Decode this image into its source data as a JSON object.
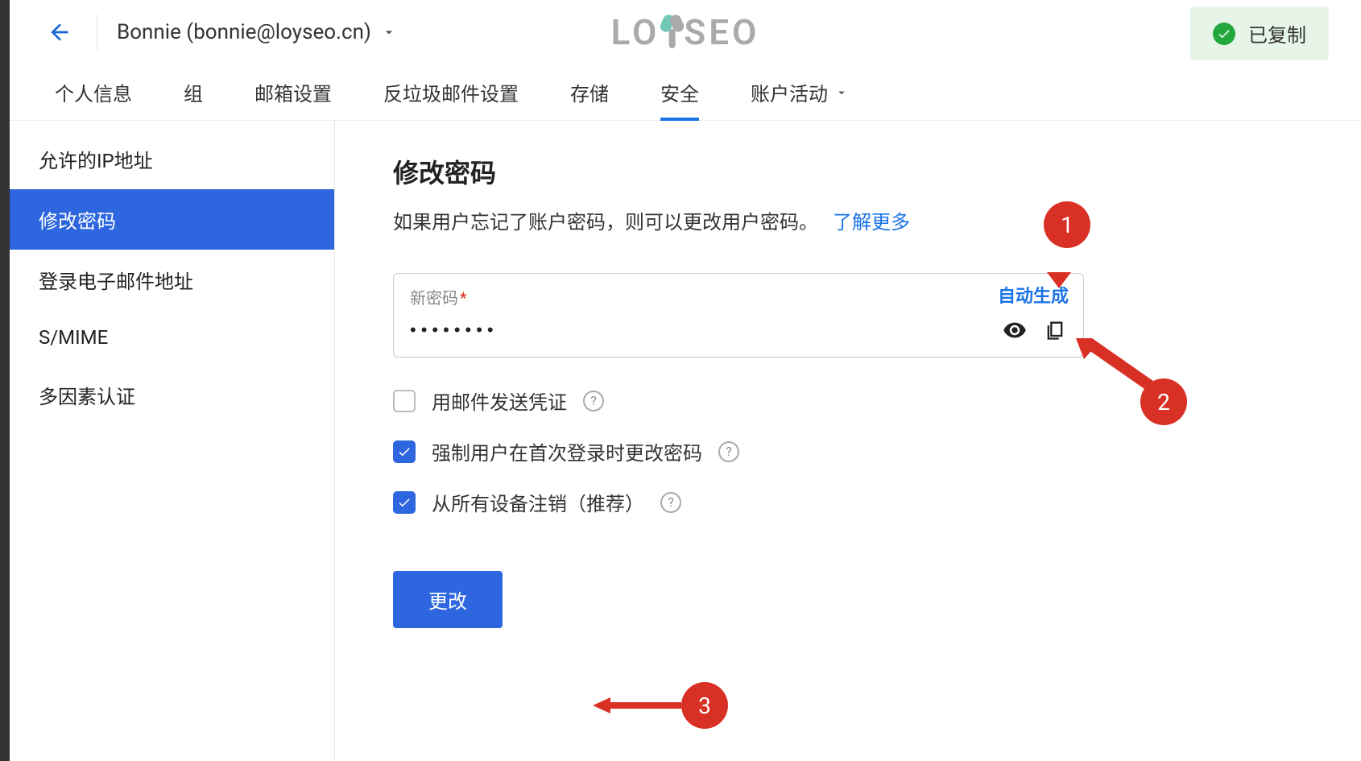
{
  "header": {
    "user_display": "Bonnie (bonnie@loyseo.cn)",
    "logo_text_left": "LO",
    "logo_text_right": "SEO",
    "toast_text": "已复制"
  },
  "tabs": [
    {
      "label": "个人信息"
    },
    {
      "label": "组"
    },
    {
      "label": "邮箱设置"
    },
    {
      "label": "反垃圾邮件设置"
    },
    {
      "label": "存储"
    },
    {
      "label": "安全",
      "active": true
    },
    {
      "label": "账户活动",
      "has_chevron": true
    }
  ],
  "sidebar": [
    {
      "label": "允许的IP地址"
    },
    {
      "label": "修改密码",
      "active": true
    },
    {
      "label": "登录电子邮件地址"
    },
    {
      "label": "S/MIME"
    },
    {
      "label": "多因素认证"
    }
  ],
  "main": {
    "title": "修改密码",
    "desc": "如果用户忘记了账户密码，则可以更改用户密码。",
    "learn_more": "了解更多",
    "field_label": "新密码",
    "required_mark": "*",
    "auto_generate": "自动生成",
    "password_value": "••••••••",
    "checkbox1": "用邮件发送凭证",
    "checkbox2": "强制用户在首次登录时更改密码",
    "checkbox3": "从所有设备注销（推荐）",
    "submit": "更改",
    "help_glyph": "?"
  },
  "annotations": {
    "n1": "1",
    "n2": "2",
    "n3": "3"
  }
}
